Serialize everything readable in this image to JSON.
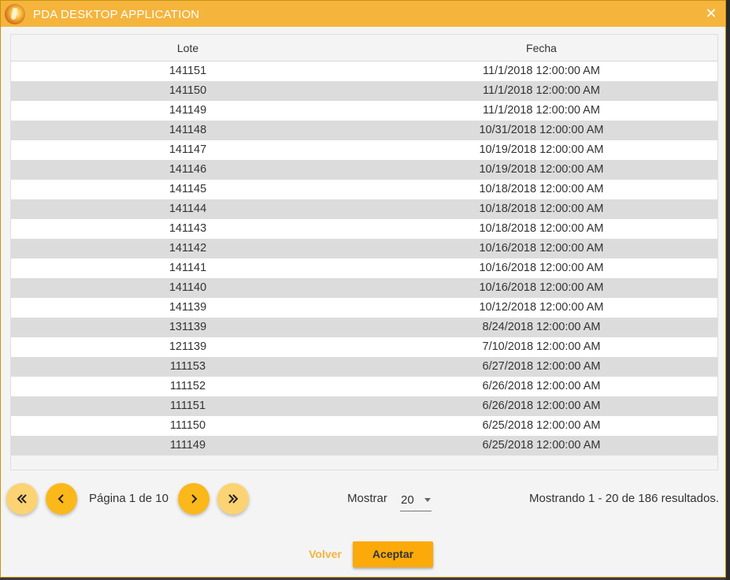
{
  "window": {
    "title": "PDA DESKTOP APPLICATION",
    "close_icon": "close-icon"
  },
  "table": {
    "headers": {
      "lote": "Lote",
      "fecha": "Fecha"
    },
    "rows": [
      {
        "lote": "141151",
        "fecha": "11/1/2018 12:00:00 AM"
      },
      {
        "lote": "141150",
        "fecha": "11/1/2018 12:00:00 AM"
      },
      {
        "lote": "141149",
        "fecha": "11/1/2018 12:00:00 AM"
      },
      {
        "lote": "141148",
        "fecha": "10/31/2018 12:00:00 AM"
      },
      {
        "lote": "141147",
        "fecha": "10/19/2018 12:00:00 AM"
      },
      {
        "lote": "141146",
        "fecha": "10/19/2018 12:00:00 AM"
      },
      {
        "lote": "141145",
        "fecha": "10/18/2018 12:00:00 AM"
      },
      {
        "lote": "141144",
        "fecha": "10/18/2018 12:00:00 AM"
      },
      {
        "lote": "141143",
        "fecha": "10/18/2018 12:00:00 AM"
      },
      {
        "lote": "141142",
        "fecha": "10/16/2018 12:00:00 AM"
      },
      {
        "lote": "141141",
        "fecha": "10/16/2018 12:00:00 AM"
      },
      {
        "lote": "141140",
        "fecha": "10/16/2018 12:00:00 AM"
      },
      {
        "lote": "141139",
        "fecha": "10/12/2018 12:00:00 AM"
      },
      {
        "lote": "131139",
        "fecha": "8/24/2018 12:00:00 AM"
      },
      {
        "lote": "121139",
        "fecha": "7/10/2018 12:00:00 AM"
      },
      {
        "lote": "111153",
        "fecha": "6/27/2018 12:00:00 AM"
      },
      {
        "lote": "111152",
        "fecha": "6/26/2018 12:00:00 AM"
      },
      {
        "lote": "111151",
        "fecha": "6/26/2018 12:00:00 AM"
      },
      {
        "lote": "111150",
        "fecha": "6/25/2018 12:00:00 AM"
      },
      {
        "lote": "111149",
        "fecha": "6/25/2018 12:00:00 AM"
      }
    ]
  },
  "pagination": {
    "page_label": "Página 1 de 10",
    "mostrar_label": "Mostrar",
    "per_page": "20",
    "results_label": "Mostrando 1 - 20 de 186 resultados.",
    "icons": {
      "first": "double-chevron-left-icon",
      "prev": "chevron-left-icon",
      "next": "chevron-right-icon",
      "last": "double-chevron-right-icon"
    }
  },
  "actions": {
    "volver": "Volver",
    "aceptar": "Aceptar"
  },
  "colors": {
    "titlebar": "#f5b43c",
    "accent": "#fbaa0a",
    "pager_button_light": "#fbd372",
    "pager_button_dark": "#fbb81a",
    "row_alt": "#dcdcdc"
  }
}
